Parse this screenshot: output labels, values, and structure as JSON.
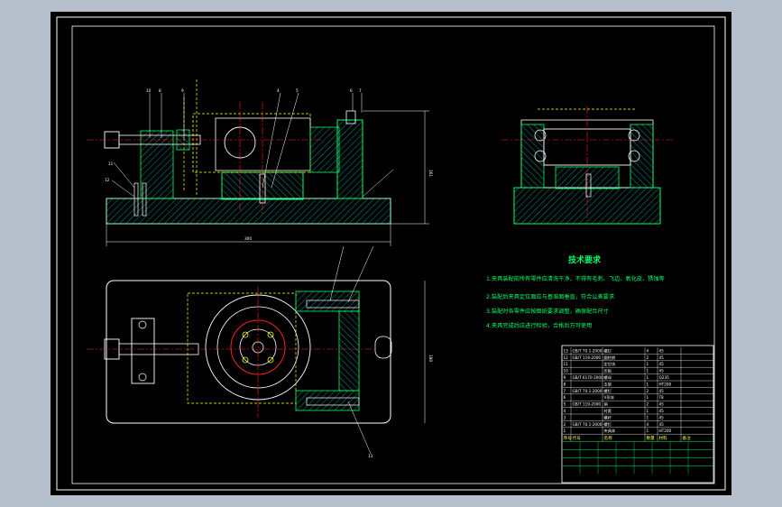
{
  "drawing": {
    "tech_title": "技术要求",
    "tech_lines": [
      "1.夹具装配前所有零件应清洗干净，不得有毛刺、飞边、氧化皮、锈蚀等",
      "2.装配后夹具定位面应与基准面垂直，符合公差要求",
      "3.装配时各零件应按图纸要求调整，确保配合尺寸",
      "4.夹具完成后应进行检验，合格后方可使用"
    ],
    "colors": {
      "background": "#000000",
      "frame": "#ffffff",
      "section_outline": "#00ff66",
      "hatch": "#00c0c0",
      "centerline": "#ff2020",
      "hidden": "#ffff00",
      "part_edge": "#ffffff"
    },
    "title_block": {
      "header": [
        "序号",
        "代号",
        "名称",
        "数量",
        "材料",
        "备注"
      ],
      "rows": [
        [
          "13",
          "GB/T 70.1-2000",
          "螺钉",
          "4",
          "45",
          ""
        ],
        [
          "12",
          "GB/T 119-2000",
          "圆柱销",
          "2",
          "45",
          ""
        ],
        [
          "11",
          "",
          "定位块",
          "1",
          "45",
          ""
        ],
        [
          "10",
          "",
          "压板",
          "1",
          "45",
          ""
        ],
        [
          "9",
          "GB/T 6170-2000",
          "螺母",
          "1",
          "Q235",
          ""
        ],
        [
          "8",
          "",
          "支架",
          "1",
          "HT200",
          ""
        ],
        [
          "7",
          "GB/T 70.1-2000",
          "螺钉",
          "2",
          "45",
          ""
        ],
        [
          "6",
          "",
          "V形块",
          "1",
          "T8",
          ""
        ],
        [
          "5",
          "GB/T 119-2000",
          "销",
          "2",
          "45",
          ""
        ],
        [
          "4",
          "",
          "衬套",
          "1",
          "45",
          ""
        ],
        [
          "3",
          "",
          "螺杆",
          "1",
          "45",
          ""
        ],
        [
          "2",
          "GB/T 70.1-2000",
          "螺钉",
          "4",
          "45",
          ""
        ],
        [
          "1",
          "",
          "夹具体",
          "1",
          "HT200",
          ""
        ]
      ]
    },
    "dimensions": {
      "overall_length": "300",
      "overall_height": "161",
      "plan_width": "180"
    },
    "balloons": [
      "4",
      "5",
      "6",
      "7",
      "8",
      "9",
      "10",
      "11",
      "12",
      "13"
    ]
  }
}
